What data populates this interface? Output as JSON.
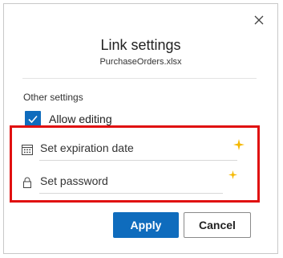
{
  "dialog": {
    "title": "Link settings",
    "file_name": "PurchaseOrders.xlsx",
    "close_icon": "close-icon"
  },
  "other_settings": {
    "label": "Other settings",
    "allow_editing": {
      "label": "Allow editing",
      "checked": true
    }
  },
  "fields": {
    "expiration": {
      "label": "Set expiration date",
      "icon": "calendar-icon"
    },
    "password": {
      "label": "Set password",
      "icon": "lock-icon"
    }
  },
  "buttons": {
    "apply_label": "Apply",
    "cancel_label": "Cancel"
  },
  "colors": {
    "accent": "#0f6cbd",
    "highlight_border": "#e01010",
    "sparkle": "#f5b800"
  }
}
